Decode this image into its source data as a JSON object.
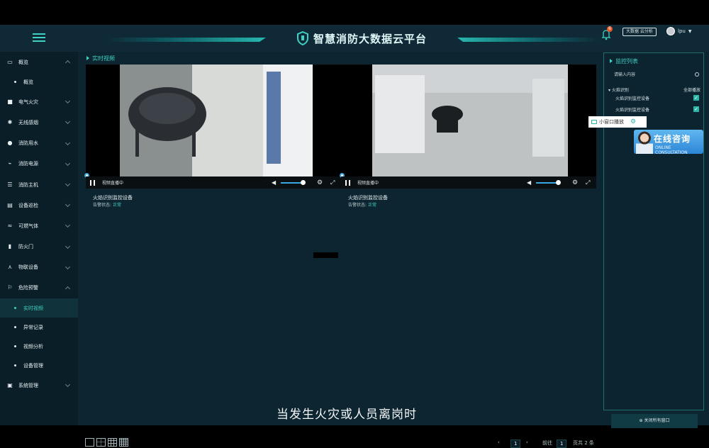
{
  "header": {
    "title": "智慧消防大数据云平台",
    "bell_count": "6",
    "pill_label": "大数据 云分析",
    "user_name": "lpu"
  },
  "sidebar": {
    "items": [
      {
        "label": "概览",
        "icon": "monitor-icon",
        "expanded": true
      },
      {
        "label": "电气火灾",
        "icon": "plug-icon"
      },
      {
        "label": "无线感烟",
        "icon": "smoke-icon"
      },
      {
        "label": "消防用水",
        "icon": "water-drop-icon"
      },
      {
        "label": "消防电源",
        "icon": "power-icon"
      },
      {
        "label": "消防主机",
        "icon": "server-icon"
      },
      {
        "label": "设备巡检",
        "icon": "inspect-icon"
      },
      {
        "label": "可燃气体",
        "icon": "gas-icon"
      },
      {
        "label": "防火门",
        "icon": "door-icon"
      },
      {
        "label": "物联设备",
        "icon": "iot-icon"
      },
      {
        "label": "危险预警",
        "icon": "warning-icon",
        "expanded": true
      },
      {
        "label": "系统管理",
        "icon": "settings-icon"
      }
    ],
    "sub_overview": "概览",
    "sub_warning": [
      "实时视频",
      "异常记录",
      "视频分析",
      "设备管理"
    ]
  },
  "main": {
    "section_title": "实时视频",
    "videos": [
      {
        "status_bar": "视频直播中",
        "device": "火焰识别监控设备",
        "alarm_label": "告警状态:",
        "alarm_value": "正常"
      },
      {
        "status_bar": "视频直播中",
        "device": "火焰识别监控设备",
        "alarm_label": "告警状态:",
        "alarm_value": "正常"
      }
    ],
    "subtitle": "当发生火灾或人员离岗时",
    "pager": {
      "prev": "‹",
      "page": "1",
      "next": "›",
      "goto_label": "前往",
      "goto_value": "1",
      "total": "页共 2 条"
    }
  },
  "right_panel": {
    "title": "监控列表",
    "search_placeholder": "请输入内容",
    "group": "火焰识别",
    "play_all": "全部播放",
    "devices": [
      "火焰识别监控设备",
      "火焰识别监控设备"
    ],
    "small_window": "小窗口播放",
    "consult_title": "在线咨询",
    "consult_sub": "ONLINE CONSULTATION",
    "close_all": "关闭所有窗口"
  },
  "colors": {
    "accent": "#3fd1c4",
    "bg": "#0d2530",
    "link": "#3aa7e0"
  }
}
